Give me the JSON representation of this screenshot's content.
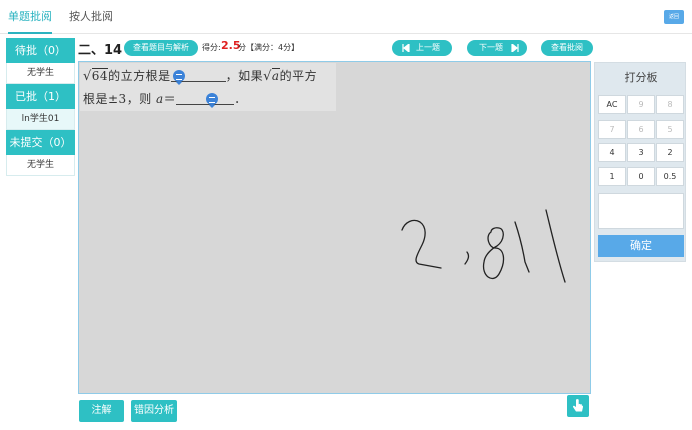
{
  "tabs": {
    "single": "单题批阅",
    "by_person": "按人批阅"
  },
  "back_label": "返回",
  "left": {
    "pending_header": "待批（0）",
    "pending_empty": "无学生",
    "done_header": "已批（1）",
    "done_student": "ln学生01",
    "unsubmitted_header": "未提交（0）",
    "unsubmitted_empty": "无学生"
  },
  "question": {
    "number": "二、14",
    "view_analysis": "查看题目与解析",
    "score_label": "得分:",
    "score_value": "2.5",
    "score_unit": "分",
    "full_score": "【满分：4分】",
    "prev": "上一题",
    "next": "下一题",
    "view_grading": "查看批阅",
    "line1_sqrt": "64",
    "line1_text": "的立方根是",
    "line1_text2": "，如果",
    "line1_sqrt2": "a",
    "line1_text3": "的平方",
    "line2_text": "根是±3，则 ",
    "line2_var": "a",
    "line2_eq": "＝",
    "line2_end": "．",
    "handwriting": "2,81"
  },
  "scorepad": {
    "title": "打分板",
    "keys": [
      "AC",
      "9",
      "8",
      "7",
      "6",
      "5",
      "4",
      "3",
      "2",
      "1",
      "0",
      "0.5"
    ],
    "confirm": "确定"
  },
  "bottom": {
    "annotate": "注解",
    "error_analysis": "错因分析"
  },
  "icons": [
    "prev-arrow-icon",
    "next-arrow-icon",
    "comment-bubble-icon",
    "hand-pointer-icon"
  ]
}
